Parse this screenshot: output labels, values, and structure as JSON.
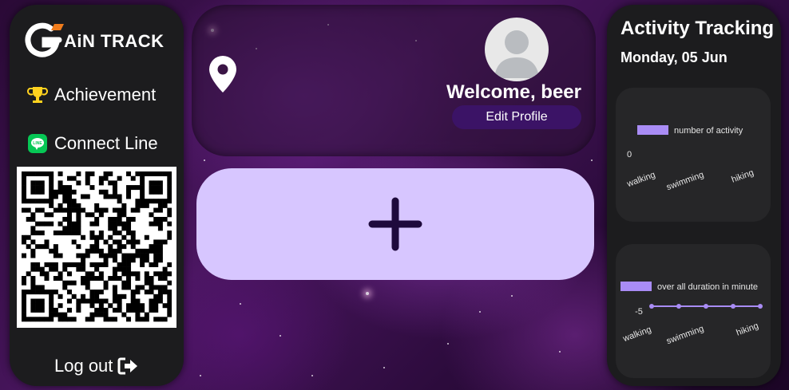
{
  "brand": {
    "logo_text": "AiN TRACK"
  },
  "sidebar": {
    "items": [
      {
        "label": "Achievement",
        "icon": "trophy-icon"
      },
      {
        "label": "Connect Line",
        "icon": "line-icon"
      }
    ],
    "logout_label": "Log out"
  },
  "profile": {
    "welcome": "Welcome, beer",
    "edit_label": "Edit Profile"
  },
  "add_button": {
    "icon": "plus-icon"
  },
  "activity": {
    "title": "Activity Tracking",
    "date": "Monday, 05 Jun"
  },
  "colors": {
    "accent": "#d7c6ff",
    "button": "#3b1366",
    "panel": "#1c1c1e",
    "bar": "#a98cf5"
  },
  "chart_data": [
    {
      "type": "bar",
      "categories": [
        "walking",
        "swimming",
        "hiking"
      ],
      "series": [
        {
          "name": "number of activity",
          "values": [
            0,
            0,
            0
          ]
        }
      ],
      "ytick_labels": [
        "0"
      ],
      "legend": "top"
    },
    {
      "type": "line",
      "categories": [
        "walking",
        "swimming",
        "hiking"
      ],
      "series": [
        {
          "name": "over all duration in minute",
          "values": [
            0,
            0,
            0
          ]
        }
      ],
      "ytick_labels": [
        "-5"
      ],
      "legend": "top"
    }
  ]
}
